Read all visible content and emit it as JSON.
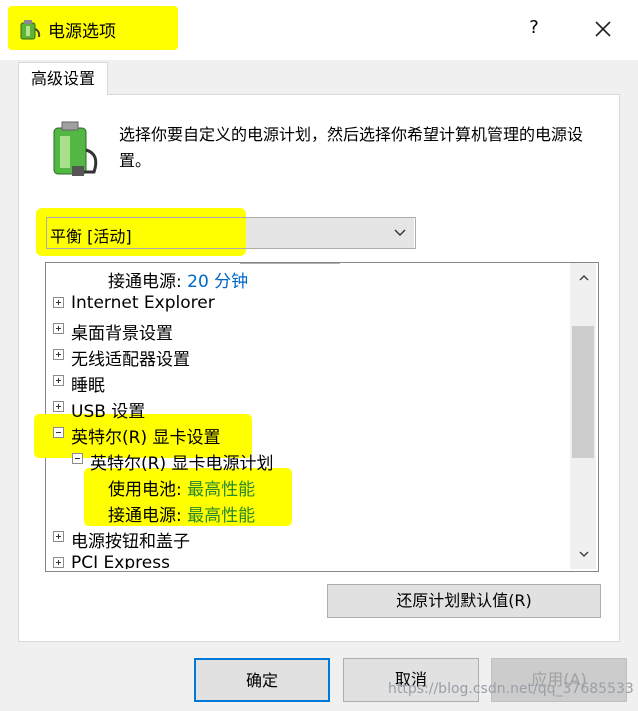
{
  "window": {
    "title": "电源选项",
    "help_label": "?",
    "icons": {
      "app": "power-plant-icon",
      "close": "close-icon"
    }
  },
  "tabs": [
    {
      "label": "高级设置",
      "active": true
    }
  ],
  "description": "选择你要自定义的电源计划，然后选择你希望计算机管理的电源设置。",
  "plan_select": {
    "value": "平衡 [活动]"
  },
  "tree": {
    "items": [
      {
        "label": "接通电源:",
        "value": "20 分钟"
      },
      {
        "label": "Internet Explorer",
        "expander": "plus"
      },
      {
        "label": "桌面背景设置",
        "expander": "plus"
      },
      {
        "label": "无线适配器设置",
        "expander": "plus"
      },
      {
        "label": "睡眠",
        "expander": "plus"
      },
      {
        "label": "USB 设置",
        "expander": "plus"
      },
      {
        "label": "英特尔(R) 显卡设置",
        "expander": "minus"
      },
      {
        "label": "英特尔(R) 显卡电源计划",
        "expander": "minus"
      },
      {
        "label": "使用电池:",
        "value": "最高性能"
      },
      {
        "label": "接通电源:",
        "value": "最高性能"
      },
      {
        "label": "电源按钮和盖子",
        "expander": "plus"
      },
      {
        "label": "PCI Express",
        "expander": "plus"
      }
    ]
  },
  "buttons": {
    "restore": "还原计划默认值(R)",
    "ok": "确定",
    "cancel": "取消",
    "apply": "应用(A)"
  },
  "watermark": "https://blog.csdn.net/qq_37685533",
  "colors": {
    "highlight": "#ffff00",
    "value_blue": "#0066cc",
    "value_green": "#2a8a2a",
    "focus_border": "#0078d7"
  }
}
